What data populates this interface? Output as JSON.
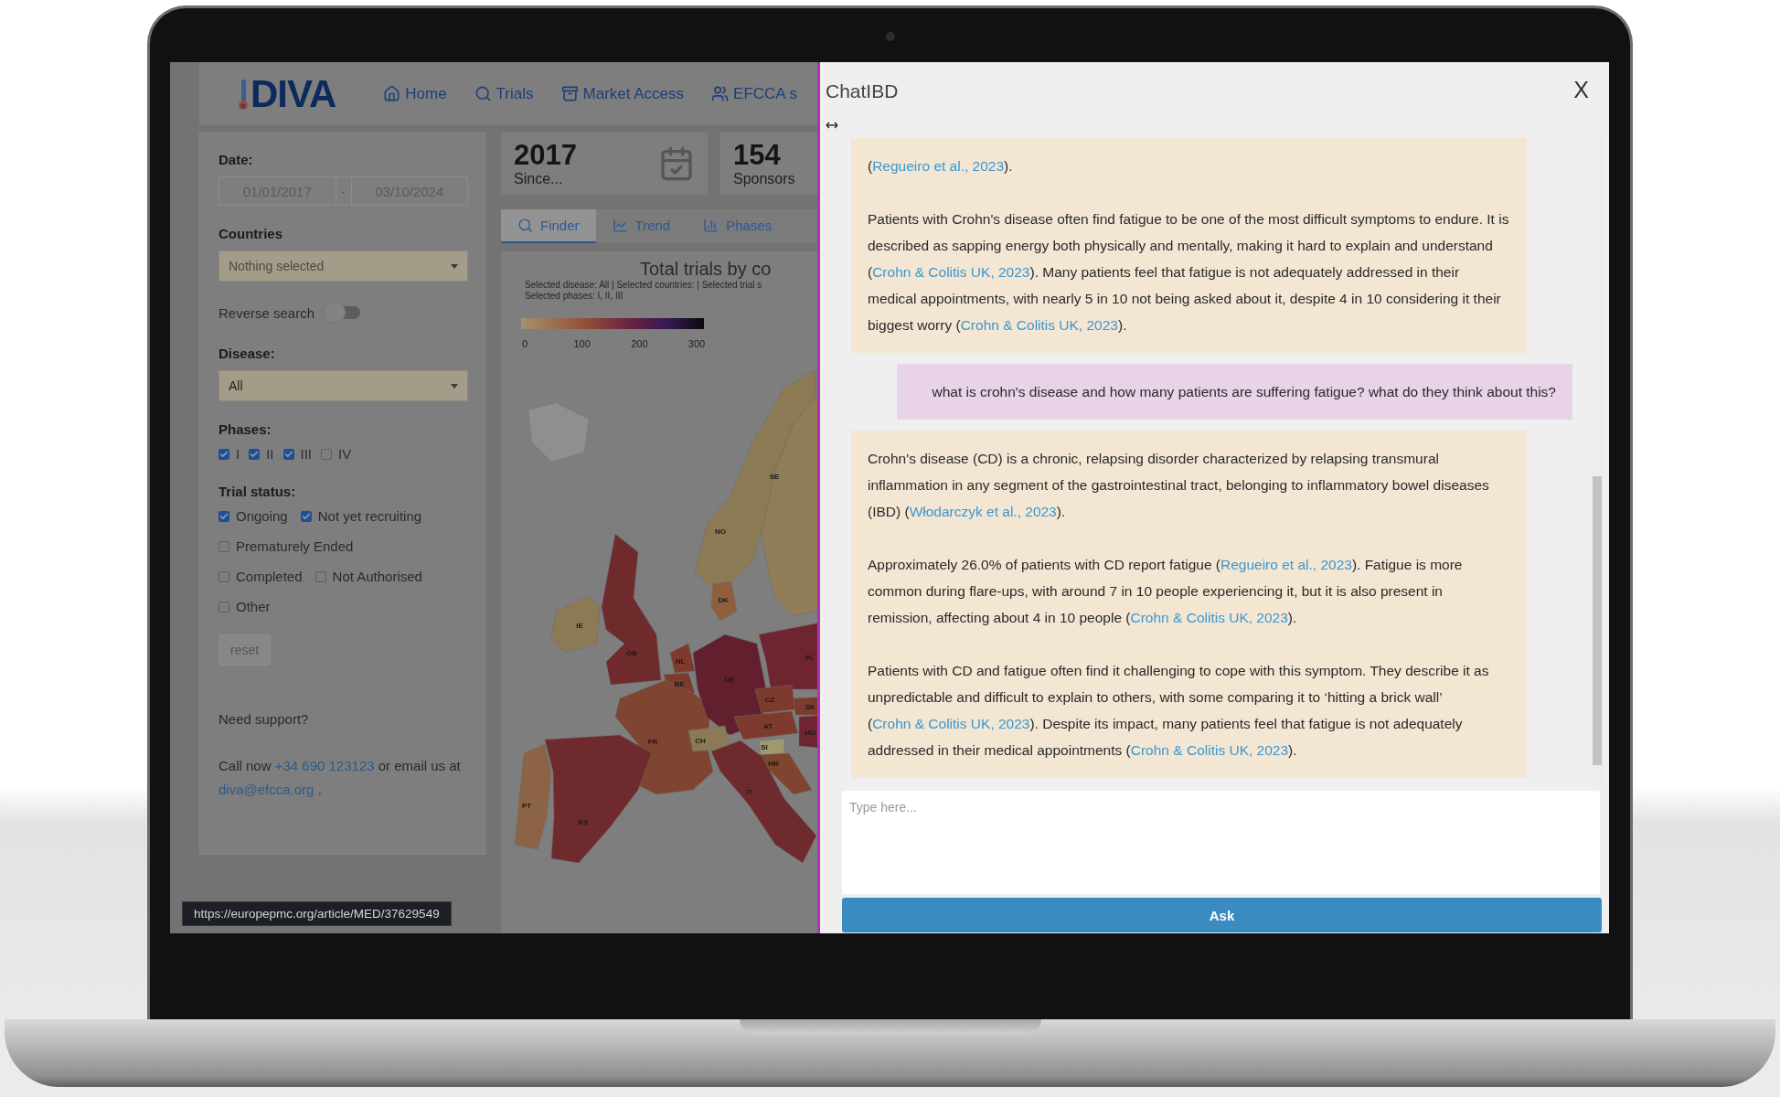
{
  "app": {
    "logo": "DIVA",
    "nav": [
      {
        "label": "Home",
        "kind": "home"
      },
      {
        "label": "Trials",
        "kind": "search"
      },
      {
        "label": "Market Access",
        "kind": "archive"
      },
      {
        "label": "EFCCA s",
        "kind": "people"
      }
    ]
  },
  "filters": {
    "date": {
      "label": "Date:",
      "from": "01/01/2017",
      "separator": "-",
      "to": "03/10/2024"
    },
    "countries": {
      "label": "Countries",
      "placeholder": "Nothing selected"
    },
    "reverse_search": {
      "label": "Reverse search",
      "on": false
    },
    "disease": {
      "label": "Disease:",
      "value": "All"
    },
    "phases": {
      "label": "Phases:",
      "options": [
        {
          "label": "I",
          "checked": true
        },
        {
          "label": "II",
          "checked": true
        },
        {
          "label": "III",
          "checked": true
        },
        {
          "label": "IV",
          "checked": false
        }
      ]
    },
    "trial_status": {
      "label": "Trial status:",
      "rows": [
        {
          "options": [
            {
              "label": "Ongoing",
              "checked": true
            },
            {
              "label": "Not yet recruiting",
              "checked": true
            }
          ]
        },
        {
          "options": [
            {
              "label": "Prematurely Ended",
              "checked": false
            }
          ]
        },
        {
          "options": [
            {
              "label": "Completed",
              "checked": false
            },
            {
              "label": "Not Authorised",
              "checked": false
            }
          ]
        },
        {
          "options": [
            {
              "label": "Other",
              "checked": false
            }
          ]
        }
      ]
    },
    "reset": "reset",
    "support": {
      "title": "Need support?",
      "before": "Call now",
      "phone": "+34 690 123123",
      "middle": "or email us at",
      "email": "diva@efcca.org",
      "after": "."
    }
  },
  "stats": [
    {
      "value": "2017",
      "label": "Since...",
      "kind": "calendar"
    },
    {
      "value": "154",
      "label": "Sponsors",
      "kind": "plain"
    }
  ],
  "tabs": [
    {
      "label": "Finder",
      "kind": "search",
      "selected": true
    },
    {
      "label": "Trend",
      "kind": "line",
      "selected": false
    },
    {
      "label": "Phases",
      "kind": "bars",
      "selected": false
    }
  ],
  "map": {
    "title": "Total trials by co",
    "subtitle": [
      "Selected disease: All | Selected countries: | Selected trial s",
      "Selected phases: I, II, III"
    ],
    "legend_ticks": [
      "0",
      "100",
      "200",
      "300"
    ],
    "countries": [
      {
        "code": "NO",
        "color": "#8c7a55"
      },
      {
        "code": "SE",
        "color": "#907c58"
      },
      {
        "code": "DK",
        "color": "#8f5f3c"
      },
      {
        "code": "IE",
        "color": "#8c7a55"
      },
      {
        "code": "GB",
        "color": "#6f2a2c"
      },
      {
        "code": "NL",
        "color": "#7e3a2c"
      },
      {
        "code": "BE",
        "color": "#7e3a2c"
      },
      {
        "code": "FR",
        "color": "#7f4530"
      },
      {
        "code": "DE",
        "color": "#62202e"
      },
      {
        "code": "PL",
        "color": "#6e2530"
      },
      {
        "code": "CZ",
        "color": "#7e3a2c"
      },
      {
        "code": "SK",
        "color": "#7e3a2d"
      },
      {
        "code": "AT",
        "color": "#7e3a2e"
      },
      {
        "code": "HU",
        "color": "#6e2531"
      },
      {
        "code": "CH",
        "color": "#8c7a56"
      },
      {
        "code": "SI",
        "color": "#9f9870"
      },
      {
        "code": "HR",
        "color": "#7f4531"
      },
      {
        "code": "IT",
        "color": "#6f2a2d"
      },
      {
        "code": "PT",
        "color": "#8c6445"
      },
      {
        "code": "ES",
        "color": "#6f2a2e"
      }
    ]
  },
  "link_preview": "https://europepmc.org/article/MED/37629549",
  "chat": {
    "title": "ChatIBD",
    "close": "X",
    "messages": [
      {
        "kind": "bot",
        "paragraphs": [
          [
            {
              "kind": "text",
              "text": "("
            },
            {
              "kind": "link",
              "text": "Regueiro et al., 2023"
            },
            {
              "kind": "text",
              "text": ")."
            }
          ],
          [
            {
              "kind": "text",
              "text": "Patients with Crohn's disease often find fatigue to be one of the most difficult symptoms to endure. It is described as sapping energy both physically and mentally, making it hard to explain and understand ("
            },
            {
              "kind": "link",
              "text": "Crohn & Colitis UK, 2023"
            },
            {
              "kind": "text",
              "text": "). Many patients feel that fatigue is not adequately addressed in their medical appointments, with nearly 5 in 10 not being asked about it, despite 4 in 10 considering it their biggest worry ("
            },
            {
              "kind": "link",
              "text": "Crohn & Colitis UK, 2023"
            },
            {
              "kind": "text",
              "text": ")."
            }
          ]
        ]
      },
      {
        "kind": "user",
        "paragraphs": [
          [
            {
              "kind": "text",
              "text": "what is crohn's disease and how many patients are suffering fatigue? what do they think about this?"
            }
          ]
        ]
      },
      {
        "kind": "bot",
        "paragraphs": [
          [
            {
              "kind": "text",
              "text": "Crohn's disease (CD) is a chronic, relapsing disorder characterized by relapsing transmural inflammation in any segment of the gastrointestinal tract, belonging to inflammatory bowel diseases (IBD) ("
            },
            {
              "kind": "link",
              "text": "Włodarczyk et al., 2023"
            },
            {
              "kind": "text",
              "text": ")."
            }
          ],
          [
            {
              "kind": "text",
              "text": "Approximately 26.0% of patients with CD report fatigue ("
            },
            {
              "kind": "link",
              "text": "Regueiro et al., 2023"
            },
            {
              "kind": "text",
              "text": "). Fatigue is more common during flare-ups, with around 7 in 10 people experiencing it, but it is also present in remission, affecting about 4 in 10 people ("
            },
            {
              "kind": "link",
              "text": "Crohn & Colitis UK, 2023"
            },
            {
              "kind": "text",
              "text": ")."
            }
          ],
          [
            {
              "kind": "text",
              "text": "Patients with CD and fatigue often find it challenging to cope with this symptom. They describe it as unpredictable and difficult to explain to others, with some comparing it to ‘hitting a brick wall’ ("
            },
            {
              "kind": "link",
              "text": "Crohn & Colitis UK, 2023"
            },
            {
              "kind": "text",
              "text": "). Despite its impact, many patients feel that fatigue is not adequately addressed in their medical appointments ("
            },
            {
              "kind": "link",
              "text": "Crohn & Colitis UK, 2023"
            },
            {
              "kind": "text",
              "text": ")."
            }
          ]
        ]
      }
    ],
    "input": {
      "placeholder": "Type here..."
    },
    "ask": "Ask"
  }
}
